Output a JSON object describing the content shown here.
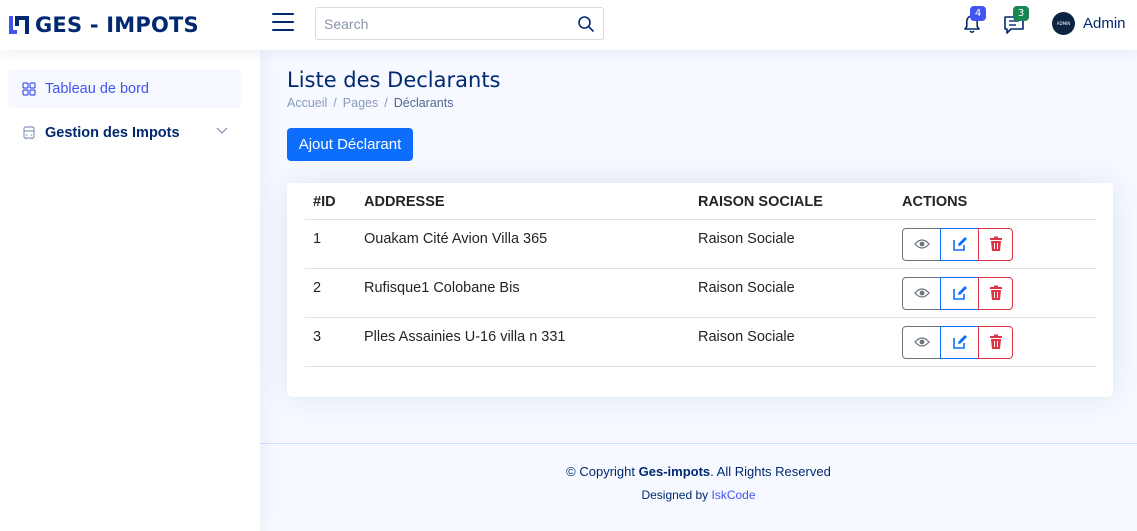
{
  "header": {
    "brand": "GES - IMPOTS",
    "search_placeholder": "Search",
    "notifications_count": "4",
    "messages_count": "3",
    "avatar_text": "ADMIN",
    "user_name": "Admin"
  },
  "sidebar": {
    "items": [
      {
        "label": "Tableau de bord",
        "icon": "grid-icon",
        "active": true
      },
      {
        "label": "Gestion des Impots",
        "icon": "building-icon",
        "active": false
      }
    ]
  },
  "main": {
    "title": "Liste des Declarants",
    "breadcrumb": [
      "Accueil",
      "/",
      "Pages",
      "/",
      "Déclarants"
    ],
    "add_button": "Ajout Déclarant",
    "table": {
      "headers": [
        "#ID",
        "ADDRESSE",
        "RAISON SOCIALE",
        "ACTIONS"
      ],
      "rows": [
        {
          "id": "1",
          "address": "Ouakam Cité Avion Villa 365",
          "raison": "Raison Sociale"
        },
        {
          "id": "2",
          "address": "Rufisque1 Colobane Bis",
          "raison": "Raison Sociale"
        },
        {
          "id": "3",
          "address": "Plles Assainies U-16 villa n 331",
          "raison": "Raison Sociale"
        }
      ]
    }
  },
  "footer": {
    "copy_prefix": "© Copyright ",
    "copy_brand": "Ges-impots",
    "copy_suffix": ". All Rights Reserved",
    "designed_by": "Designed by ",
    "designer": "IskCode"
  },
  "colors": {
    "primary": "#0d6efd",
    "brand": "#012970",
    "accent": "#4154f1",
    "danger": "#dc3545",
    "success": "#198754",
    "background": "#f6f9ff"
  }
}
